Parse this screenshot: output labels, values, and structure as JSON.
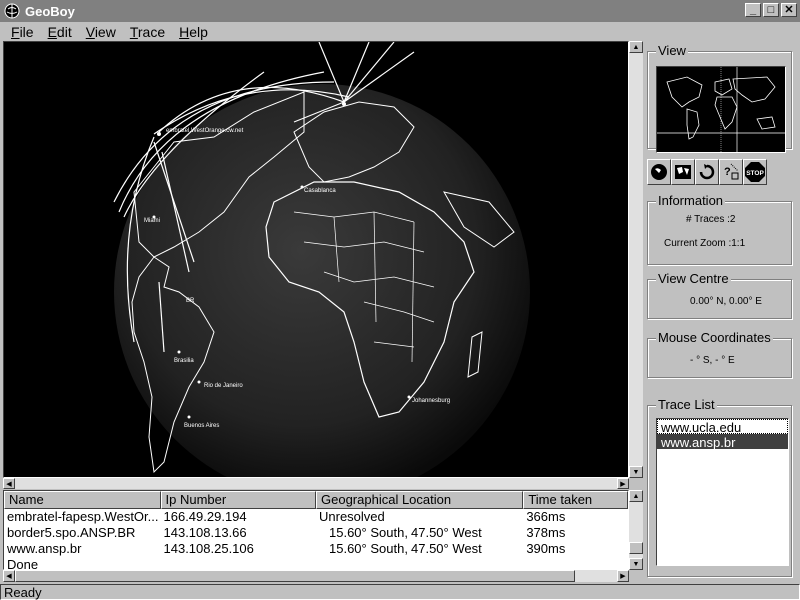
{
  "window": {
    "title": "GeoBoy"
  },
  "menu": [
    {
      "label": "File",
      "key": "F",
      "rest": "ile"
    },
    {
      "label": "Edit",
      "key": "E",
      "rest": "dit"
    },
    {
      "label": "View",
      "key": "V",
      "rest": "iew"
    },
    {
      "label": "Trace",
      "key": "T",
      "rest": "race"
    },
    {
      "label": "Help",
      "key": "H",
      "rest": "elp"
    }
  ],
  "globe_labels": {
    "westorange": "embratel.WestOrange.cw.net",
    "miami": "Miami",
    "br": "BR",
    "brasilia": "Brasilia",
    "rio": "Rio de Janeiro",
    "buenos_aires": "Buenos Aires",
    "casablanca": "Casablanca",
    "johannesburg": "Johannesburg"
  },
  "table": {
    "headers": [
      "Name",
      "Ip Number",
      "Geographical Location",
      "Time taken"
    ],
    "rows": [
      {
        "name": "embratel-fapesp.WestOr...",
        "ip": "166.49.29.194",
        "lat": "Unresolved",
        "lon": "",
        "time": "366ms"
      },
      {
        "name": "border5.spo.ANSP.BR",
        "ip": "143.108.13.66",
        "lat": "15.60° South,",
        "lon": "47.50° West",
        "time": "378ms"
      },
      {
        "name": "www.ansp.br",
        "ip": "143.108.25.106",
        "lat": "15.60° South,",
        "lon": "47.50° West",
        "time": "390ms"
      }
    ],
    "done_text": "Done"
  },
  "status": {
    "text": "Ready"
  },
  "side": {
    "view_title": "View",
    "information_title": "Information",
    "traces_line": "# Traces :2",
    "zoom_line": "Current Zoom :1:1",
    "view_centre_title": "View Centre",
    "view_centre_value": "0.00° N, 0.00° E",
    "mouse_title": "Mouse Coordinates",
    "mouse_value": "-   ° S,   -   ° E",
    "trace_list_title": "Trace List",
    "trace_list": [
      "www.ucla.edu",
      "www.ansp.br"
    ],
    "toolbar_icons": [
      "globe-icon",
      "map-icon",
      "rotate-icon",
      "query-icon",
      "stop-icon"
    ],
    "stop_label": "STOP"
  }
}
